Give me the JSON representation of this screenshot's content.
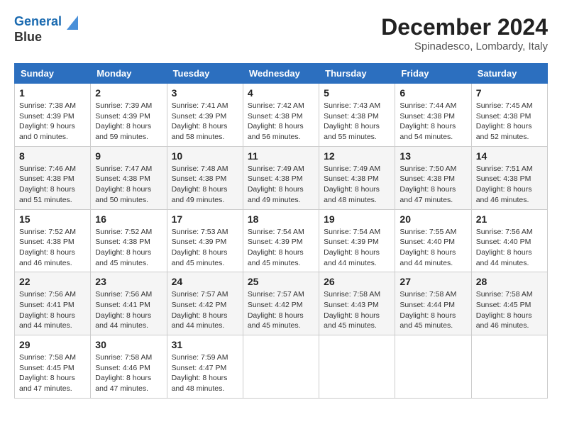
{
  "logo": {
    "line1": "General",
    "line2": "Blue"
  },
  "title": "December 2024",
  "location": "Spinadesco, Lombardy, Italy",
  "days_header": [
    "Sunday",
    "Monday",
    "Tuesday",
    "Wednesday",
    "Thursday",
    "Friday",
    "Saturday"
  ],
  "weeks": [
    [
      {
        "day": "1",
        "info": "Sunrise: 7:38 AM\nSunset: 4:39 PM\nDaylight: 9 hours\nand 0 minutes."
      },
      {
        "day": "2",
        "info": "Sunrise: 7:39 AM\nSunset: 4:39 PM\nDaylight: 8 hours\nand 59 minutes."
      },
      {
        "day": "3",
        "info": "Sunrise: 7:41 AM\nSunset: 4:39 PM\nDaylight: 8 hours\nand 58 minutes."
      },
      {
        "day": "4",
        "info": "Sunrise: 7:42 AM\nSunset: 4:38 PM\nDaylight: 8 hours\nand 56 minutes."
      },
      {
        "day": "5",
        "info": "Sunrise: 7:43 AM\nSunset: 4:38 PM\nDaylight: 8 hours\nand 55 minutes."
      },
      {
        "day": "6",
        "info": "Sunrise: 7:44 AM\nSunset: 4:38 PM\nDaylight: 8 hours\nand 54 minutes."
      },
      {
        "day": "7",
        "info": "Sunrise: 7:45 AM\nSunset: 4:38 PM\nDaylight: 8 hours\nand 52 minutes."
      }
    ],
    [
      {
        "day": "8",
        "info": "Sunrise: 7:46 AM\nSunset: 4:38 PM\nDaylight: 8 hours\nand 51 minutes."
      },
      {
        "day": "9",
        "info": "Sunrise: 7:47 AM\nSunset: 4:38 PM\nDaylight: 8 hours\nand 50 minutes."
      },
      {
        "day": "10",
        "info": "Sunrise: 7:48 AM\nSunset: 4:38 PM\nDaylight: 8 hours\nand 49 minutes."
      },
      {
        "day": "11",
        "info": "Sunrise: 7:49 AM\nSunset: 4:38 PM\nDaylight: 8 hours\nand 49 minutes."
      },
      {
        "day": "12",
        "info": "Sunrise: 7:49 AM\nSunset: 4:38 PM\nDaylight: 8 hours\nand 48 minutes."
      },
      {
        "day": "13",
        "info": "Sunrise: 7:50 AM\nSunset: 4:38 PM\nDaylight: 8 hours\nand 47 minutes."
      },
      {
        "day": "14",
        "info": "Sunrise: 7:51 AM\nSunset: 4:38 PM\nDaylight: 8 hours\nand 46 minutes."
      }
    ],
    [
      {
        "day": "15",
        "info": "Sunrise: 7:52 AM\nSunset: 4:38 PM\nDaylight: 8 hours\nand 46 minutes."
      },
      {
        "day": "16",
        "info": "Sunrise: 7:52 AM\nSunset: 4:38 PM\nDaylight: 8 hours\nand 45 minutes."
      },
      {
        "day": "17",
        "info": "Sunrise: 7:53 AM\nSunset: 4:39 PM\nDaylight: 8 hours\nand 45 minutes."
      },
      {
        "day": "18",
        "info": "Sunrise: 7:54 AM\nSunset: 4:39 PM\nDaylight: 8 hours\nand 45 minutes."
      },
      {
        "day": "19",
        "info": "Sunrise: 7:54 AM\nSunset: 4:39 PM\nDaylight: 8 hours\nand 44 minutes."
      },
      {
        "day": "20",
        "info": "Sunrise: 7:55 AM\nSunset: 4:40 PM\nDaylight: 8 hours\nand 44 minutes."
      },
      {
        "day": "21",
        "info": "Sunrise: 7:56 AM\nSunset: 4:40 PM\nDaylight: 8 hours\nand 44 minutes."
      }
    ],
    [
      {
        "day": "22",
        "info": "Sunrise: 7:56 AM\nSunset: 4:41 PM\nDaylight: 8 hours\nand 44 minutes."
      },
      {
        "day": "23",
        "info": "Sunrise: 7:56 AM\nSunset: 4:41 PM\nDaylight: 8 hours\nand 44 minutes."
      },
      {
        "day": "24",
        "info": "Sunrise: 7:57 AM\nSunset: 4:42 PM\nDaylight: 8 hours\nand 44 minutes."
      },
      {
        "day": "25",
        "info": "Sunrise: 7:57 AM\nSunset: 4:42 PM\nDaylight: 8 hours\nand 45 minutes."
      },
      {
        "day": "26",
        "info": "Sunrise: 7:58 AM\nSunset: 4:43 PM\nDaylight: 8 hours\nand 45 minutes."
      },
      {
        "day": "27",
        "info": "Sunrise: 7:58 AM\nSunset: 4:44 PM\nDaylight: 8 hours\nand 45 minutes."
      },
      {
        "day": "28",
        "info": "Sunrise: 7:58 AM\nSunset: 4:45 PM\nDaylight: 8 hours\nand 46 minutes."
      }
    ],
    [
      {
        "day": "29",
        "info": "Sunrise: 7:58 AM\nSunset: 4:45 PM\nDaylight: 8 hours\nand 47 minutes."
      },
      {
        "day": "30",
        "info": "Sunrise: 7:58 AM\nSunset: 4:46 PM\nDaylight: 8 hours\nand 47 minutes."
      },
      {
        "day": "31",
        "info": "Sunrise: 7:59 AM\nSunset: 4:47 PM\nDaylight: 8 hours\nand 48 minutes."
      },
      {
        "day": "",
        "info": ""
      },
      {
        "day": "",
        "info": ""
      },
      {
        "day": "",
        "info": ""
      },
      {
        "day": "",
        "info": ""
      }
    ]
  ]
}
